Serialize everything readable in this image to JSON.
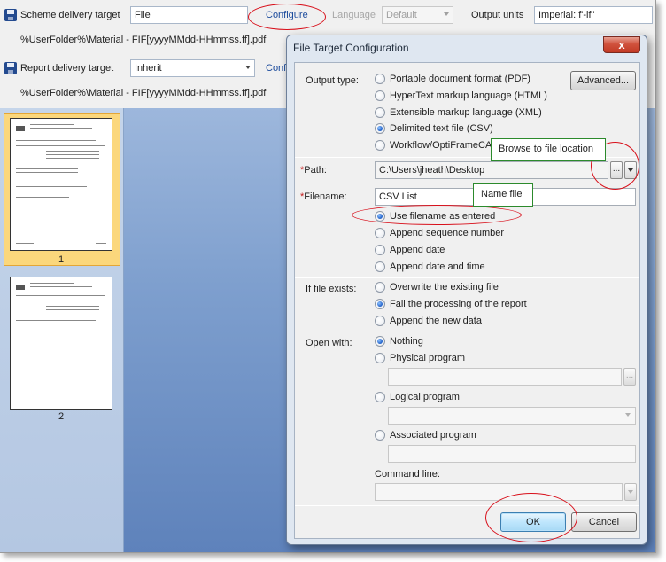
{
  "back": {
    "scheme": {
      "label": "Scheme delivery target",
      "value": "File",
      "configure": "Configure",
      "path": "%UserFolder%\\Material - FIF[yyyyMMdd-HHmmss.ff].pdf"
    },
    "language": {
      "label": "Language",
      "value": "Default"
    },
    "output_units": {
      "label": "Output units",
      "value": "Imperial: f'-if\""
    },
    "report": {
      "label": "Report delivery target",
      "value": "Inherit",
      "configure": "Confi",
      "path": "%UserFolder%\\Material - FIF[yyyyMMdd-HHmmss.ff].pdf"
    },
    "pages": [
      "1",
      "2"
    ]
  },
  "dialog": {
    "title": "File Target Configuration",
    "close": "x",
    "output_type": {
      "label": "Output type:",
      "advanced": "Advanced...",
      "options": [
        {
          "label": "Portable document format (PDF)",
          "checked": false
        },
        {
          "label": "HyperText markup language (HTML)",
          "checked": false
        },
        {
          "label": "Extensible markup language (XML)",
          "checked": false
        },
        {
          "label": "Delimited text file (CSV)",
          "checked": true
        },
        {
          "label": "Workflow/OptiFrameCA",
          "checked": false
        }
      ]
    },
    "path": {
      "marker": "*",
      "label": "Path:",
      "value": "C:\\Users\\jheath\\Desktop",
      "browse": "..."
    },
    "filename": {
      "marker": "*",
      "label": "Filename:",
      "value": "CSV List",
      "options": [
        {
          "label": "Use filename as entered",
          "checked": true
        },
        {
          "label": "Append sequence number",
          "checked": false
        },
        {
          "label": "Append date",
          "checked": false
        },
        {
          "label": "Append date and time",
          "checked": false
        }
      ]
    },
    "if_exists": {
      "label": "If file exists:",
      "options": [
        {
          "label": "Overwrite the existing file",
          "checked": false
        },
        {
          "label": "Fail the processing of the report",
          "checked": true
        },
        {
          "label": "Append the new data",
          "checked": false
        }
      ]
    },
    "open_with": {
      "label": "Open with:",
      "nothing": "Nothing",
      "physical": "Physical program",
      "physical_browse": "...",
      "logical": "Logical program",
      "associated": "Associated program",
      "command_line": "Command line:"
    },
    "ok": "OK",
    "cancel": "Cancel"
  },
  "annotations": {
    "browse_callout": "Browse to file location",
    "name_callout": "Name file"
  },
  "colors": {
    "annotation_red": "#d8101b",
    "callout_border": "#2c8a2c",
    "thumb_selected": "#fbd77c"
  }
}
